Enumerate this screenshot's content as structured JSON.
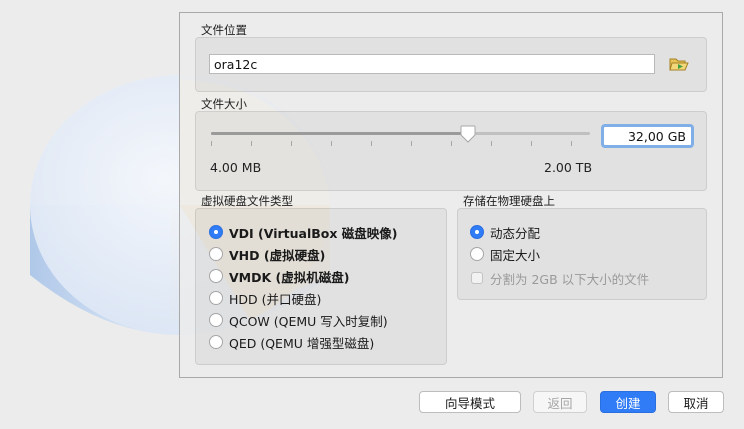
{
  "location": {
    "section_title": "文件位置",
    "value": "ora12c"
  },
  "size": {
    "section_title": "文件大小",
    "value": "32,00 GB",
    "min_label": "4.00 MB",
    "max_label": "2.00 TB",
    "slider_fraction": 0.67
  },
  "file_type": {
    "section_title": "虚拟硬盘文件类型",
    "options": [
      {
        "label": "VDI (VirtualBox 磁盘映像)",
        "selected": true
      },
      {
        "label": "VHD (虚拟硬盘)",
        "selected": false
      },
      {
        "label": "VMDK (虚拟机磁盘)",
        "selected": false
      },
      {
        "label": "HDD (并口硬盘)",
        "selected": false
      },
      {
        "label": "QCOW (QEMU 写入时复制)",
        "selected": false
      },
      {
        "label": "QED (QEMU 增强型磁盘)",
        "selected": false
      }
    ]
  },
  "storage": {
    "section_title": "存储在物理硬盘上",
    "options": [
      {
        "label": "动态分配",
        "selected": true
      },
      {
        "label": "固定大小",
        "selected": false
      }
    ],
    "split_checkbox": {
      "label": "分割为 2GB 以下大小的文件",
      "checked": false,
      "enabled": false
    }
  },
  "buttons": {
    "guided": "向导模式",
    "back": "返回",
    "create": "创建",
    "cancel": "取消"
  },
  "colors": {
    "accent": "#2f7cf6",
    "focus_ring": "#80aee6"
  },
  "icons": {
    "folder": "folder-open-icon",
    "disk": "hard-disk-illustration"
  }
}
